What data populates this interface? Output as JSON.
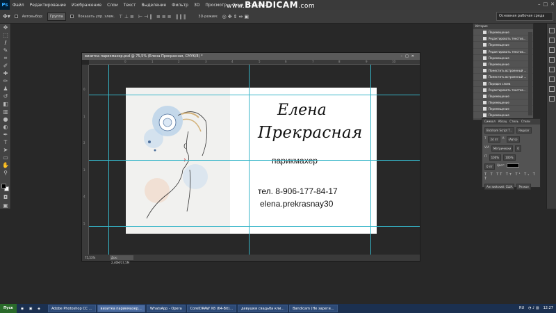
{
  "watermark": {
    "brand": "BANDICAM",
    "www": "www.",
    "tld": ".com"
  },
  "app": {
    "logo": "Ps"
  },
  "menu": [
    "Файл",
    "Редактирование",
    "Изображение",
    "Слои",
    "Текст",
    "Выделение",
    "Фильтр",
    "3D",
    "Просмотр",
    "Окно",
    "Справка"
  ],
  "options": {
    "auto_select_label": "Автовыбор:",
    "auto_select_value": "Группа",
    "show_controls": "Показать упр. элем.",
    "mode_3d": "3D-режим:",
    "workspace": "Основная рабочая среда"
  },
  "document": {
    "title": "визитка парикмахер.psd @ 75,5% (Елена  Прекрасная, CMYK/8) *",
    "zoom": "75,53%",
    "doc_size": "Док: 2,46M/17,5M",
    "ruler_h": [
      "0",
      "1",
      "2",
      "3",
      "4",
      "5",
      "6",
      "7",
      "8",
      "9",
      "10"
    ],
    "ruler_v": [
      "0",
      "1",
      "2",
      "3",
      "4",
      "5"
    ]
  },
  "card": {
    "name_first": "Елена",
    "name_last": "Прекрасная",
    "profession": "парикмахер",
    "phone": "тел. 8-906-177-84-17",
    "email": "elena.prekrasnay30"
  },
  "history": {
    "tabs": [
      "История"
    ],
    "items": [
      "Перемещение",
      "Редактировать текстов...",
      "Перемещение",
      "Редактировать текстов...",
      "Перемещение",
      "Перемещение",
      "Поместить встроенный ...",
      "Поместить встроенный ...",
      "Порядок слоев",
      "Редактировать текстов...",
      "Перемещение",
      "Перемещение",
      "Перемещение",
      "Перемещение"
    ]
  },
  "character": {
    "tabs": [
      "Символ",
      "Абзац",
      "Стиль",
      "Стили"
    ],
    "font": "Bickham Script T...",
    "font_style": "Regular",
    "size": "24 пт",
    "leading": "(Авто)",
    "kerning": "Метрически",
    "tracking": "0",
    "scale_v": "100%",
    "scale_h": "100%",
    "baseline": "0 пт",
    "color_label": "Цвет:",
    "language": "Английский: США",
    "aa": "Резкое"
  },
  "taskbar": {
    "start": "Пуск",
    "items": [
      "Adobe Photoshop CC ...",
      "визитка парикмахер...",
      "WhatsApp - Opera",
      "CorelDRAW X8 (64-Bit)...",
      "девушки свадьба кли...",
      "Bandicam (Не зареги..."
    ],
    "lang": "RU",
    "time": "12:27"
  }
}
